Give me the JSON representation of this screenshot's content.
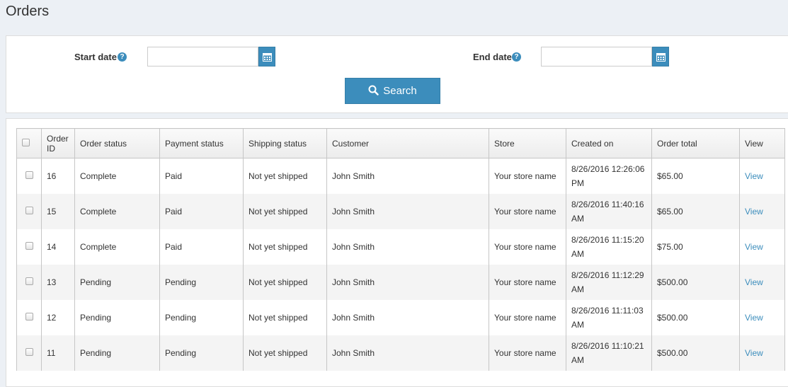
{
  "page": {
    "title": "Orders"
  },
  "filters": {
    "start_label": "Start date",
    "end_label": "End date",
    "help_glyph": "?",
    "start_value": "",
    "end_value": "",
    "search_label": "Search"
  },
  "colors": {
    "accent": "#3c8dbc",
    "link": "#3c8dbc",
    "background": "#ecf0f5"
  },
  "table": {
    "headers": {
      "order_id": "Order ID",
      "order_status": "Order status",
      "payment_status": "Payment status",
      "shipping_status": "Shipping status",
      "customer": "Customer",
      "store": "Store",
      "created_on": "Created on",
      "order_total": "Order total",
      "view": "View"
    },
    "rows": [
      {
        "id": "16",
        "order_status": "Complete",
        "payment_status": "Paid",
        "shipping_status": "Not yet shipped",
        "customer": "John Smith",
        "store": "Your store name",
        "created_on": "8/26/2016 12:26:06 PM",
        "total": "$65.00",
        "view": "View"
      },
      {
        "id": "15",
        "order_status": "Complete",
        "payment_status": "Paid",
        "shipping_status": "Not yet shipped",
        "customer": "John Smith",
        "store": "Your store name",
        "created_on": "8/26/2016 11:40:16 AM",
        "total": "$65.00",
        "view": "View"
      },
      {
        "id": "14",
        "order_status": "Complete",
        "payment_status": "Paid",
        "shipping_status": "Not yet shipped",
        "customer": "John Smith",
        "store": "Your store name",
        "created_on": "8/26/2016 11:15:20 AM",
        "total": "$75.00",
        "view": "View"
      },
      {
        "id": "13",
        "order_status": "Pending",
        "payment_status": "Pending",
        "shipping_status": "Not yet shipped",
        "customer": "John Smith",
        "store": "Your store name",
        "created_on": "8/26/2016 11:12:29 AM",
        "total": "$500.00",
        "view": "View"
      },
      {
        "id": "12",
        "order_status": "Pending",
        "payment_status": "Pending",
        "shipping_status": "Not yet shipped",
        "customer": "John Smith",
        "store": "Your store name",
        "created_on": "8/26/2016 11:11:03 AM",
        "total": "$500.00",
        "view": "View"
      },
      {
        "id": "11",
        "order_status": "Pending",
        "payment_status": "Pending",
        "shipping_status": "Not yet shipped",
        "customer": "John Smith",
        "store": "Your store name",
        "created_on": "8/26/2016 11:10:21 AM",
        "total": "$500.00",
        "view": "View"
      }
    ]
  }
}
